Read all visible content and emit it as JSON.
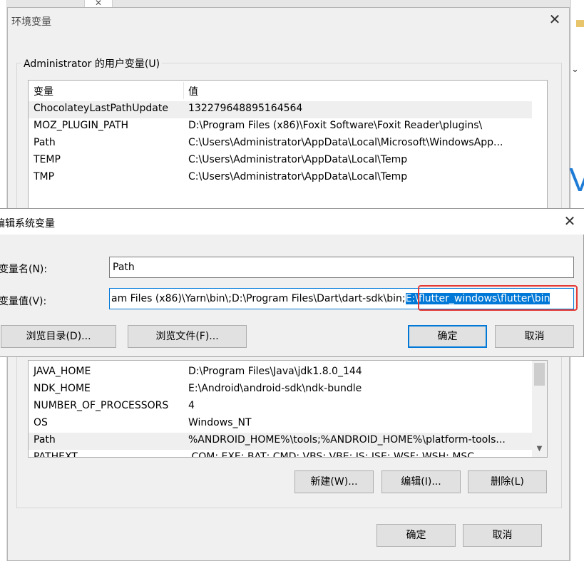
{
  "background": {
    "close_glyph": "✕",
    "right_chevron": "⌄",
    "right_letter": "V"
  },
  "env_dialog": {
    "title": "环境变量",
    "close_glyph": "✕",
    "user_group_label": "Administrator 的用户变量(U)",
    "columns": {
      "name": "变量",
      "value": "值"
    },
    "user_vars": [
      {
        "name": "ChocolateyLastPathUpdate",
        "value": "132279648895164564"
      },
      {
        "name": "MOZ_PLUGIN_PATH",
        "value": "D:\\Program Files (x86)\\Foxit Software\\Foxit Reader\\plugins\\"
      },
      {
        "name": "Path",
        "value": "C:\\Users\\Administrator\\AppData\\Local\\Microsoft\\WindowsApp..."
      },
      {
        "name": "TEMP",
        "value": "C:\\Users\\Administrator\\AppData\\Local\\Temp"
      },
      {
        "name": "TMP",
        "value": "C:\\Users\\Administrator\\AppData\\Local\\Temp"
      }
    ],
    "system_vars": [
      {
        "name": "JAVA_HOME",
        "value": "D:\\Program Files\\Java\\jdk1.8.0_144"
      },
      {
        "name": "NDK_HOME",
        "value": "E:\\Android\\android-sdk\\ndk-bundle"
      },
      {
        "name": "NUMBER_OF_PROCESSORS",
        "value": "4"
      },
      {
        "name": "OS",
        "value": "Windows_NT"
      },
      {
        "name": "Path",
        "value": "%ANDROID_HOME%\\tools;%ANDROID_HOME%\\platform-tools..."
      },
      {
        "name": "PATHEXT",
        "value": ".COM;.EXE;.BAT;.CMD;.VBS;.VBE;.JS;.JSE;.WSF;.WSH;.MSC"
      }
    ],
    "system_buttons": {
      "new": "新建(W)...",
      "edit": "编辑(I)...",
      "delete": "删除(L)"
    },
    "ok": "确定",
    "cancel": "取消"
  },
  "edit_dialog": {
    "title": "编辑系统变量",
    "close_glyph": "✕",
    "name_label": "变量名(N):",
    "value_label": "变量值(V):",
    "name_value": "Path",
    "value_text_before": "am Files (x86)\\Yarn\\bin\\;D:\\Program Files\\Dart\\dart-sdk\\bin;",
    "value_text_selected": "E:\\flutter_windows\\flutter\\bin",
    "browse_dir": "浏览目录(D)...",
    "browse_file": "浏览文件(F)...",
    "ok": "确定",
    "cancel": "取消"
  },
  "colors": {
    "accent": "#0078d7",
    "highlight_ring": "#e53935"
  }
}
